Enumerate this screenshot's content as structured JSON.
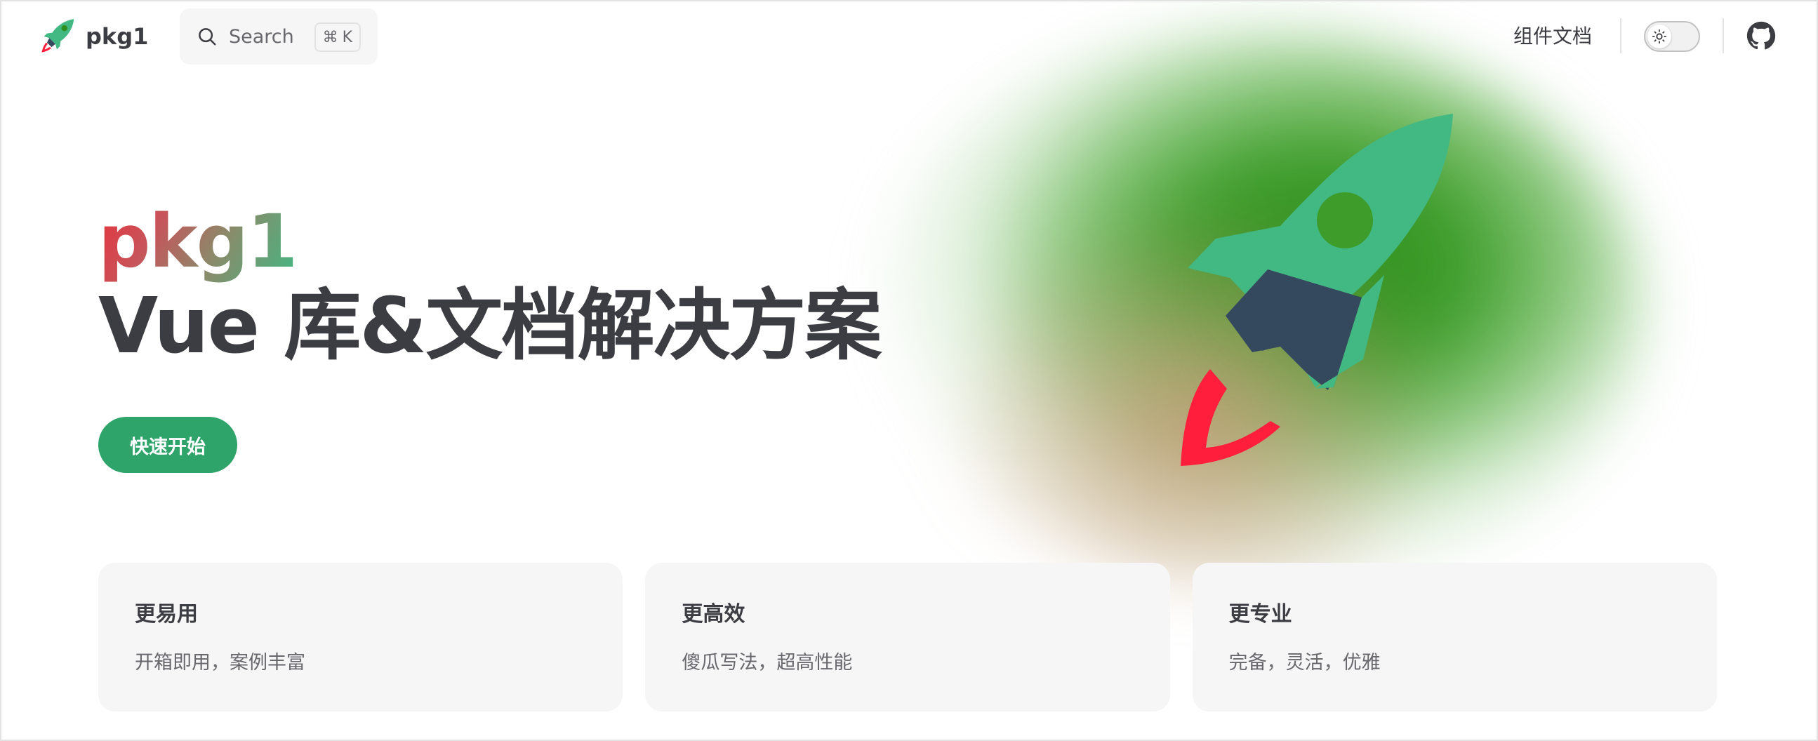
{
  "nav": {
    "brand": "pkg1",
    "search_label": "Search",
    "search_shortcut_symbol": "⌘",
    "search_shortcut_key": "K",
    "links": [
      "组件文档"
    ],
    "icons": [
      "search-icon",
      "sun-icon",
      "github-icon",
      "rocket-logo-icon"
    ]
  },
  "hero": {
    "name": "pkg1",
    "text": "Vue 库&文档解决方案",
    "action": "快速开始",
    "image": "rocket-icon"
  },
  "features": [
    {
      "title": "更易用",
      "details": "开箱即用，案例丰富"
    },
    {
      "title": "更高效",
      "details": "傻瓜写法，超高性能"
    },
    {
      "title": "更专业",
      "details": "完备，灵活，优雅"
    }
  ],
  "colors": {
    "brand": "#2fa46a",
    "rocket_body": "#42b883",
    "rocket_wing": "#35495e",
    "rocket_flame": "#ff1f3d",
    "text": "#3c3c43",
    "text_muted": "#67676c",
    "card_bg": "#f6f6f7"
  }
}
